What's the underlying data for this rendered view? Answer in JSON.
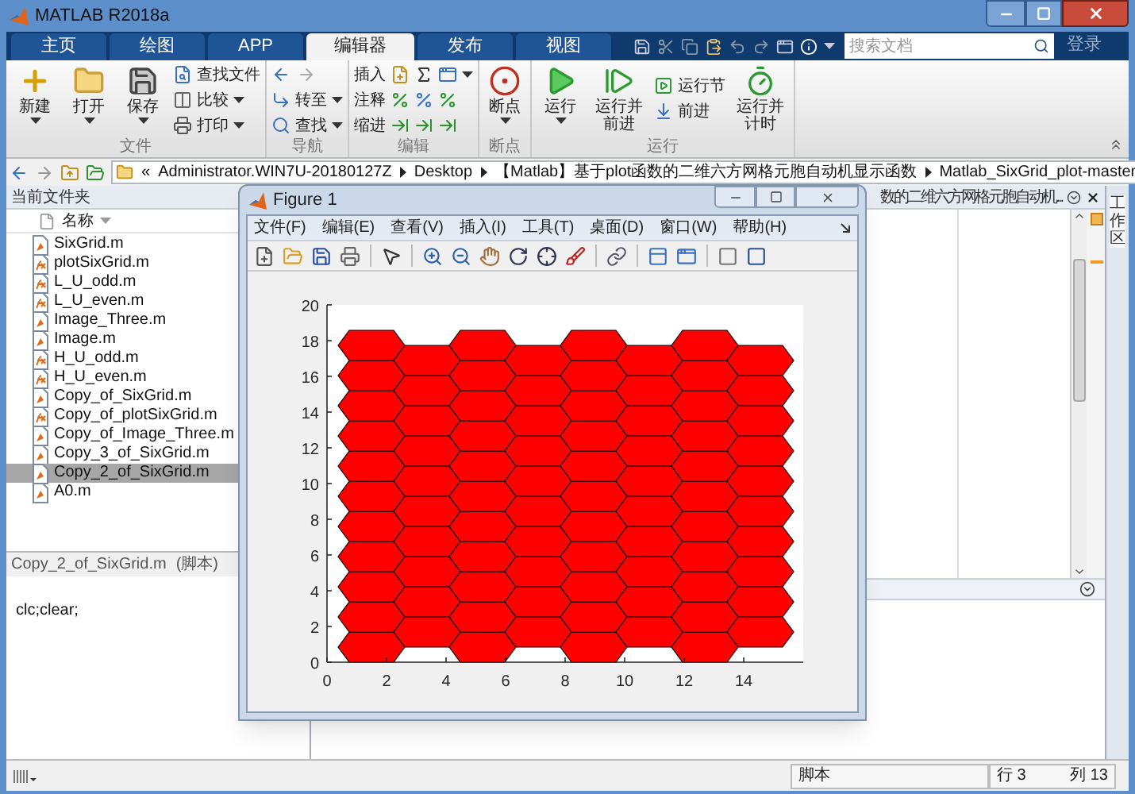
{
  "window": {
    "title": "MATLAB R2018a"
  },
  "ribbon_tabs": [
    {
      "label": "主页",
      "selected": false
    },
    {
      "label": "绘图",
      "selected": false
    },
    {
      "label": "APP",
      "selected": false
    },
    {
      "label": "编辑器",
      "selected": true
    },
    {
      "label": "发布",
      "selected": false
    },
    {
      "label": "视图",
      "selected": false
    }
  ],
  "search": {
    "placeholder": "搜索文档"
  },
  "sign_in": "登录",
  "ribbon": {
    "file": {
      "label": "文件",
      "new": "新建",
      "open": "打开",
      "save": "保存",
      "find_files": "查找文件",
      "compare": "比较",
      "print": "打印"
    },
    "navigate": {
      "label": "导航",
      "go_to": "转至",
      "find": "查找"
    },
    "edit": {
      "label": "编辑",
      "insert": "插入",
      "comment": "注释",
      "indent": "缩进"
    },
    "breakpoints": {
      "label": "断点",
      "breakpoints": "断点"
    },
    "run": {
      "label": "运行",
      "run": "运行",
      "run_and_advance": "运行并前进",
      "run_section": "运行节",
      "advance": "前进",
      "run_and_time": "运行并计时"
    }
  },
  "address": {
    "prefix": "«",
    "path": [
      "Administrator.WIN7U-20180127Z",
      "Desktop",
      "【Matlab】基于plot函数的二维六方网格元胞自动机显示函数",
      "Matlab_SixGrid_plot-master"
    ]
  },
  "current_folder": {
    "title": "当前文件夹",
    "column": "名称",
    "files": [
      {
        "name": "SixGrid.m",
        "kind": "script",
        "selected": false
      },
      {
        "name": "plotSixGrid.m",
        "kind": "function",
        "selected": false
      },
      {
        "name": "L_U_odd.m",
        "kind": "function",
        "selected": false
      },
      {
        "name": "L_U_even.m",
        "kind": "function",
        "selected": false
      },
      {
        "name": "Image_Three.m",
        "kind": "script",
        "selected": false
      },
      {
        "name": "Image.m",
        "kind": "script",
        "selected": false
      },
      {
        "name": "H_U_odd.m",
        "kind": "function",
        "selected": false
      },
      {
        "name": "H_U_even.m",
        "kind": "function",
        "selected": false
      },
      {
        "name": "Copy_of_SixGrid.m",
        "kind": "script",
        "selected": false
      },
      {
        "name": "Copy_of_plotSixGrid.m",
        "kind": "function",
        "selected": false
      },
      {
        "name": "Copy_of_Image_Three.m",
        "kind": "script",
        "selected": false
      },
      {
        "name": "Copy_3_of_SixGrid.m",
        "kind": "script",
        "selected": false
      },
      {
        "name": "Copy_2_of_SixGrid.m",
        "kind": "script",
        "selected": true
      },
      {
        "name": "A0.m",
        "kind": "script",
        "selected": false
      }
    ]
  },
  "details": {
    "title": "Copy_2_of_SixGrid.m",
    "type": "(脚本)",
    "content": "clc;clear;"
  },
  "editor": {
    "tab_label": "数的二维六方网格元胞自动机..."
  },
  "side_panel": {
    "label": "工作区"
  },
  "status_bar": {
    "mode": "脚本",
    "line_label": "行",
    "line": "3",
    "column_label": "列",
    "column": "13"
  },
  "figure": {
    "title": "Figure 1",
    "menus": [
      "文件(F)",
      "编辑(E)",
      "查看(V)",
      "插入(I)",
      "工具(T)",
      "桌面(D)",
      "窗口(W)",
      "帮助(H)"
    ],
    "axes": {
      "yticks": [
        "20",
        "18",
        "16",
        "14",
        "12",
        "10",
        "8",
        "6",
        "4",
        "2",
        "0"
      ],
      "xticks": [
        "0",
        "2",
        "4",
        "6",
        "8",
        "10",
        "12",
        "14"
      ]
    }
  }
}
